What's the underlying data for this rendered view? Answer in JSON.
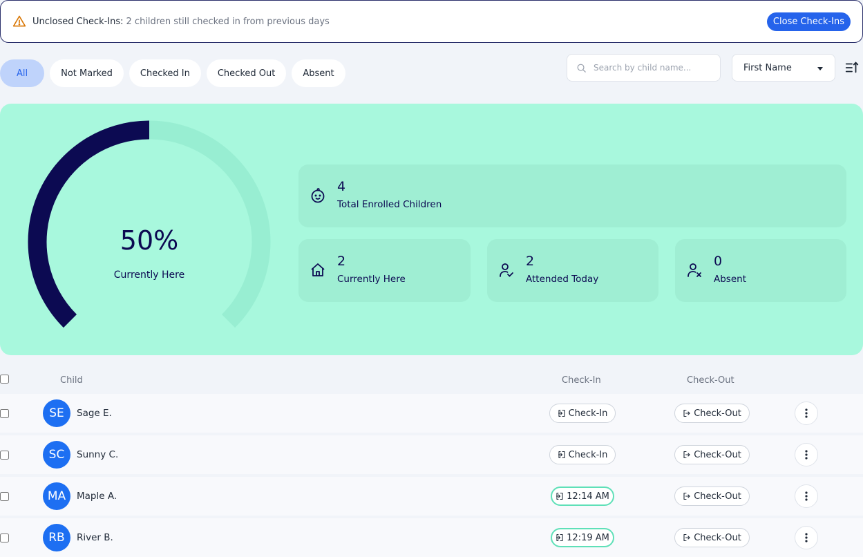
{
  "banner": {
    "title": "Unclosed Check-Ins:",
    "message": "2 children still checked in from previous days",
    "action_label": "Close Check-Ins",
    "icon": "warning-icon"
  },
  "filters": {
    "chips": [
      "All",
      "Not Marked",
      "Checked In",
      "Checked Out",
      "Absent"
    ],
    "active": "All"
  },
  "search": {
    "placeholder": "Search by child name...",
    "value": ""
  },
  "sort": {
    "selected": "First Name",
    "direction_icon": "sort-ascending-icon"
  },
  "stats": {
    "gauge_percent_label": "50%",
    "gauge_fraction": 0.5,
    "gauge_label": "Currently Here",
    "total_enrolled": {
      "value": "4",
      "label": "Total Enrolled Children",
      "icon": "baby-face-icon"
    },
    "currently_here": {
      "value": "2",
      "label": "Currently Here",
      "icon": "home-icon"
    },
    "attended_today": {
      "value": "2",
      "label": "Attended Today",
      "icon": "user-check-icon"
    },
    "absent": {
      "value": "0",
      "label": "Absent",
      "icon": "user-x-icon"
    }
  },
  "table": {
    "headers": {
      "child": "Child",
      "check_in": "Check-In",
      "check_out": "Check-Out"
    },
    "rows": [
      {
        "initials": "SE",
        "name": "Sage E.",
        "check_in": "Check-In",
        "check_in_done": false,
        "check_out": "Check-Out"
      },
      {
        "initials": "SC",
        "name": "Sunny C.",
        "check_in": "Check-In",
        "check_in_done": false,
        "check_out": "Check-Out"
      },
      {
        "initials": "MA",
        "name": "Maple A.",
        "check_in": "12:14 AM",
        "check_in_done": true,
        "check_out": "Check-Out"
      },
      {
        "initials": "RB",
        "name": "River B.",
        "check_in": "12:19 AM",
        "check_in_done": true,
        "check_out": "Check-Out"
      }
    ]
  },
  "colors": {
    "primary": "#2563eb",
    "panel": "#a8f8dd",
    "card": "#9feed3",
    "gauge_fill": "#0c0a52",
    "gauge_track": "#98eed2",
    "avatar": "#1d6ff2",
    "checked_in_border": "#5fe0b8"
  }
}
